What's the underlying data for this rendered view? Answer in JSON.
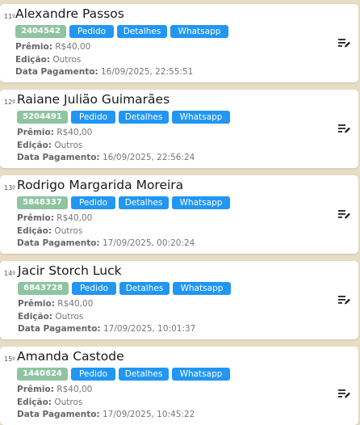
{
  "labels": {
    "premio": "Prêmio:",
    "edicao": "Edição:",
    "data_pagamento": "Data Pagamento:",
    "pedido": "Pedido",
    "detalhes": "Detalhes",
    "whatsapp": "Whatsapp"
  },
  "colors": {
    "id_badge": "#8ec4a0",
    "button": "#2196f3",
    "background": "#e7ddc4"
  },
  "entries": [
    {
      "rank": "11º",
      "name": "Alexandre Passos",
      "id": "2404542",
      "premio": "R$40,00",
      "edicao": "Outros",
      "data_pagamento": "16/09/2025, 22:55:51"
    },
    {
      "rank": "12º",
      "name": "Raiane Julião Guimarães",
      "id": "5204491",
      "premio": "R$40,00",
      "edicao": "Outros",
      "data_pagamento": "16/09/2025, 22:56:24"
    },
    {
      "rank": "13º",
      "name": "Rodrigo Margarida Moreira",
      "id": "5848337",
      "premio": "R$40,00",
      "edicao": "Outros",
      "data_pagamento": "17/09/2025, 00:20:24"
    },
    {
      "rank": "14º",
      "name": "Jacir Storch Luck",
      "id": "6843728",
      "premio": "R$40,00",
      "edicao": "Outros",
      "data_pagamento": "17/09/2025, 10:01:37"
    },
    {
      "rank": "15º",
      "name": "Amanda Castode",
      "id": "1440624",
      "premio": "R$40,00",
      "edicao": "Outros",
      "data_pagamento": "17/09/2025, 10:45:22"
    }
  ]
}
